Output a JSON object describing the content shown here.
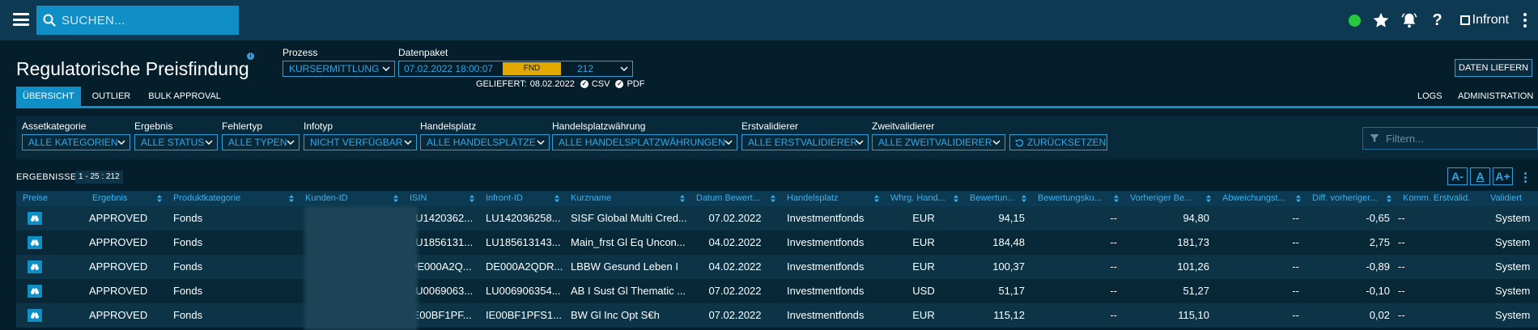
{
  "topbar": {
    "search_placeholder": "SUCHEN...",
    "brand": "Infront",
    "status_color": "#27c93f"
  },
  "header": {
    "title": "Regulatorische Preisfindung",
    "prozess_label": "Prozess",
    "prozess_value": "KURSERMITTLUNG",
    "datenpaket_label": "Datenpaket",
    "datenpaket_date": "07.02.2022 18:00:07",
    "datenpaket_status": "FND",
    "datenpaket_number": "212",
    "geliefert_label": "GELIEFERT:",
    "geliefert_date": "08.02.2022",
    "csv_label": "CSV",
    "pdf_label": "PDF",
    "daten_liefern_label": "DATEN LIEFERN"
  },
  "tabs": [
    {
      "label": "ÜBERSICHT"
    },
    {
      "label": "OUTLIER"
    },
    {
      "label": "BULK APPROVAL"
    }
  ],
  "right_tabs": {
    "logs": "LOGS",
    "administration": "ADMINISTRATION"
  },
  "filters": [
    {
      "label": "Assetkategorie",
      "value": "ALLE KATEGORIEN"
    },
    {
      "label": "Ergebnis",
      "value": "ALLE STATUS"
    },
    {
      "label": "Fehlertyp",
      "value": "ALLE TYPEN"
    },
    {
      "label": "Infotyp",
      "value": "NICHT VERFÜGBAR"
    },
    {
      "label": "Handelsplatz",
      "value": "ALLE HANDELSPLÄTZE"
    },
    {
      "label": "Handelsplatzwährung",
      "value": "ALLE HANDELSPLATZWÄHRUNGEN"
    },
    {
      "label": "Erstvalidierer",
      "value": "ALLE ERSTVALIDIERER"
    },
    {
      "label": "Zweitvalidierer",
      "value": "ALLE ZWEITVALIDIERER"
    }
  ],
  "reset_label": "ZURÜCKSETZEN",
  "filter_placeholder": "Filtern...",
  "results": {
    "label": "ERGEBNISSE",
    "count": "1 - 25 : 212"
  },
  "font_buttons": [
    "A-",
    "A",
    "A+"
  ],
  "columns": [
    "Preise",
    "Ergebnis",
    "Produktkategorie",
    "Kunden-ID",
    "ISIN",
    "Infront-ID",
    "Kurzname",
    "Datum Bewert...",
    "Handelsplatz",
    "Whrg. Hand...",
    "Bewertun...",
    "Bewertungsku...",
    "Vorheriger Be...",
    "Abweichungst...",
    "Diff. vorheriger...",
    "Komm. Erstvalid.",
    "Validiert"
  ],
  "rows": [
    {
      "ergebnis": "APPROVED",
      "produktkategorie": "Fonds",
      "isin": "LU1420362...",
      "infront_id": "LU142036258...",
      "kurzname": "SISF Global Multi Cred...",
      "datum": "07.02.2022",
      "handelsplatz": "Investmentfonds",
      "waehrung": "EUR",
      "bewertung": "94,15",
      "bewertungskurs": "--",
      "vorheriger": "94,80",
      "abweichung": "--",
      "diff": "-0,65",
      "komm": "--",
      "validiert": "System"
    },
    {
      "ergebnis": "APPROVED",
      "produktkategorie": "Fonds",
      "isin": "LU1856131...",
      "infront_id": "LU185613143...",
      "kurzname": "Main_frst Gl Eq Uncon...",
      "datum": "04.02.2022",
      "handelsplatz": "Investmentfonds",
      "waehrung": "EUR",
      "bewertung": "184,48",
      "bewertungskurs": "--",
      "vorheriger": "181,73",
      "abweichung": "--",
      "diff": "2,75",
      "komm": "--",
      "validiert": "System"
    },
    {
      "ergebnis": "APPROVED",
      "produktkategorie": "Fonds",
      "isin": "DE000A2Q...",
      "infront_id": "DE000A2QDR...",
      "kurzname": "LBBW Gesund Leben I",
      "datum": "04.02.2022",
      "handelsplatz": "Investmentfonds",
      "waehrung": "EUR",
      "bewertung": "100,37",
      "bewertungskurs": "--",
      "vorheriger": "101,26",
      "abweichung": "--",
      "diff": "-0,89",
      "komm": "--",
      "validiert": "System"
    },
    {
      "ergebnis": "APPROVED",
      "produktkategorie": "Fonds",
      "isin": "LU0069063...",
      "infront_id": "LU006906354...",
      "kurzname": "AB I Sust Gl Thematic ...",
      "datum": "07.02.2022",
      "handelsplatz": "Investmentfonds",
      "waehrung": "USD",
      "bewertung": "51,17",
      "bewertungskurs": "--",
      "vorheriger": "51,27",
      "abweichung": "--",
      "diff": "-0,10",
      "komm": "--",
      "validiert": "System"
    },
    {
      "ergebnis": "APPROVED",
      "produktkategorie": "Fonds",
      "isin": "IE00BF1PF...",
      "infront_id": "IE00BF1PFS1...",
      "kurzname": "BW Gl Inc Opt S€h",
      "datum": "07.02.2022",
      "handelsplatz": "Investmentfonds",
      "waehrung": "EUR",
      "bewertung": "115,12",
      "bewertungskurs": "--",
      "vorheriger": "115,10",
      "abweichung": "--",
      "diff": "0,02",
      "komm": "--",
      "validiert": "System"
    }
  ],
  "colors": {
    "accent": "#0f8fc6",
    "header_bg": "#0d3a52",
    "page_bg": "#041e2b",
    "badge": "#e0a800"
  }
}
